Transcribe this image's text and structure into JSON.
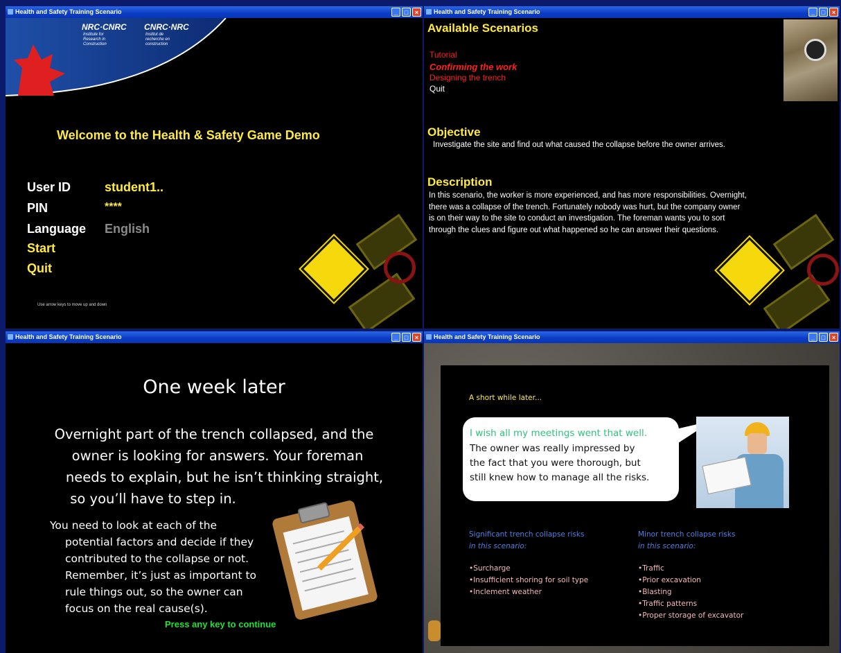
{
  "window_title": "Health and Safety Training Scenario",
  "login": {
    "logo_en": "NRC·CNRC",
    "logo_fr": "CNRC·NRC",
    "logo_text_en": [
      "Institute for",
      "Research in",
      "Construction"
    ],
    "logo_text_fr": [
      "Institut de",
      "recherche en",
      "construction"
    ],
    "welcome": "Welcome to the Health & Safety Game Demo",
    "user_id_label": "User ID",
    "user_id_value": "student1..",
    "pin_label": "PIN",
    "pin_value": "****",
    "language_label": "Language",
    "language_value": "English",
    "start_label": "Start",
    "quit_label": "Quit",
    "hint": "Use arrow keys to move up and down"
  },
  "scenarios": {
    "heading": "Available Scenarios",
    "items": [
      "Tutorial",
      "Confirming the work",
      "Designing the trench",
      "Quit"
    ],
    "objective_heading": "Objective",
    "objective_text": "Investigate the site and find out what caused the collapse before the owner arrives.",
    "description_heading": "Description",
    "description_lines": [
      "In this scenario, the worker is more experienced, and has more responsibilities. Overnight,",
      "there was a collapse of the trench. Fortunately nobody was hurt, but the company owner",
      "is on their way to the site to conduct an investigation. The foreman wants you to sort",
      "through the clues and figure out what happened so he can answer their questions."
    ]
  },
  "story": {
    "title": "One week later",
    "para1_lines": [
      "Overnight part of the trench collapsed, and the",
      "owner is looking for answers. Your foreman",
      "needs to explain, but he isn’t thinking straight,",
      "so you’ll have to step in."
    ],
    "para2_lines": [
      "You need to look at each of the",
      "potential factors and decide if they",
      "contributed to the collapse or not.",
      "Remember, it’s just as important to",
      "rule things out, so the owner can",
      "focus on the real cause(s)."
    ],
    "continue": "Press any key to continue"
  },
  "result": {
    "intro": "A short while later...",
    "bubble_quote": "I wish all my meetings went that well.",
    "bubble_lines": [
      "The owner was really impressed by",
      "the fact that you were thorough, but",
      "still knew how to manage all the risks."
    ],
    "significant_heading": "Significant trench collapse risks",
    "significant_sub": "in this scenario:",
    "significant_items": [
      "•Surcharge",
      "•Insufficient shoring for soil type",
      "•Inclement weather"
    ],
    "minor_heading": "Minor trench collapse risks",
    "minor_sub": "in this scenario:",
    "minor_items": [
      "•Traffic",
      "•Prior excavation",
      "•Blasting",
      "•Traffic patterns",
      "•Proper storage of excavator"
    ]
  },
  "colors": {
    "title_yellow": "#ffeb3b",
    "heading_yellow": "#ffeb3b",
    "scenario_red": "#ff2020",
    "continue_green": "#22e03a",
    "quote_green": "#2ec27e",
    "list_blue": "#4f7fe0",
    "list_pink": "#f6b8b8"
  }
}
